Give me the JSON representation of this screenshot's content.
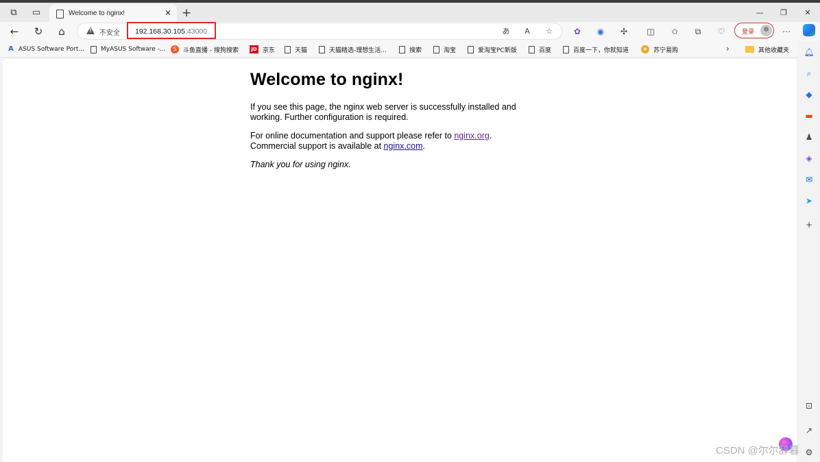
{
  "browser": {
    "tab": {
      "title": "Welcome to nginx!"
    },
    "address": {
      "security_label": "不安全",
      "url_host": "192.168.30.105",
      "url_port": ":43000"
    },
    "login_label": "登录"
  },
  "bookmarks": [
    {
      "label": "ASUS Software Port...",
      "icon": "asus-icon"
    },
    {
      "label": "MyASUS Software -...",
      "icon": "page-icon"
    },
    {
      "label": "斗鱼直播 - 搜狗搜索",
      "icon": "sogou-icon"
    },
    {
      "label": "京东",
      "icon": "jd-icon"
    },
    {
      "label": "天猫",
      "icon": "page-icon"
    },
    {
      "label": "天猫精选-理想生活...",
      "icon": "page-icon"
    },
    {
      "label": "搜索",
      "icon": "page-icon"
    },
    {
      "label": "淘宝",
      "icon": "page-icon"
    },
    {
      "label": "爱淘宝PC新版",
      "icon": "page-icon"
    },
    {
      "label": "百度",
      "icon": "page-icon"
    },
    {
      "label": "百度一下，你就知道",
      "icon": "page-icon"
    },
    {
      "label": "苏宁易购",
      "icon": "suning-icon"
    },
    {
      "label": "其他收藏夹",
      "icon": "folder-icon"
    }
  ],
  "page": {
    "heading": "Welcome to nginx!",
    "intro": "If you see this page, the nginx web server is successfully installed and working. Further configuration is required.",
    "docs_prefix": "For online documentation and support please refer to ",
    "docs_link": "nginx.org",
    "docs_suffix": ".",
    "commercial_prefix": "Commercial support is available at ",
    "commercial_link": "nginx.com",
    "commercial_suffix": ".",
    "thanks": "Thank you for using nginx."
  },
  "watermark": "CSDN @尔尔辞暮",
  "colors": {
    "highlight_box": "#e0262b",
    "link": "#1a0dab",
    "visited_link": "#5c2699"
  }
}
